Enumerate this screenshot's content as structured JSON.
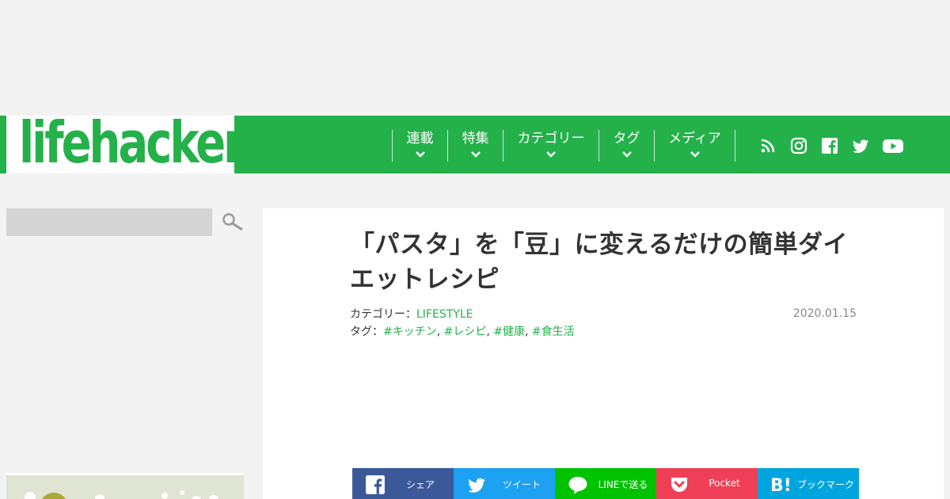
{
  "header": {
    "logo_text": "lifehacker",
    "nav": [
      {
        "label": "連載"
      },
      {
        "label": "特集"
      },
      {
        "label": "カテゴリー"
      },
      {
        "label": "タグ"
      },
      {
        "label": "メディア"
      }
    ],
    "social_icons": [
      "rss-icon",
      "instagram-icon",
      "facebook-icon",
      "twitter-icon",
      "youtube-icon"
    ]
  },
  "search": {
    "placeholder": ""
  },
  "article": {
    "title": "「パスタ」を「豆」に変えるだけの簡単ダイエットレシピ",
    "category_label": "カテゴリー：",
    "category": "LIFESTYLE",
    "tag_label": "タグ：",
    "tags": [
      "#キッチン",
      "#レシピ",
      "#健康",
      "#食生活"
    ],
    "tag_sep": ",",
    "date": "2020.01.15"
  },
  "share": [
    {
      "label": "シェア",
      "icon": "facebook-icon",
      "color": "#3b5998"
    },
    {
      "label": "ツイート",
      "icon": "twitter-icon",
      "color": "#1da1f2"
    },
    {
      "label": "LINEで送る",
      "icon": "line-icon",
      "color": "#00c300"
    },
    {
      "label": "Pocket",
      "icon": "pocket-icon",
      "color": "#ef3f56"
    },
    {
      "label": "ブックマーク",
      "icon": "hatena-bookmark-icon",
      "color": "#00a4de"
    }
  ],
  "colors": {
    "brand": "#24b14a",
    "background": "#f3f3f3"
  }
}
